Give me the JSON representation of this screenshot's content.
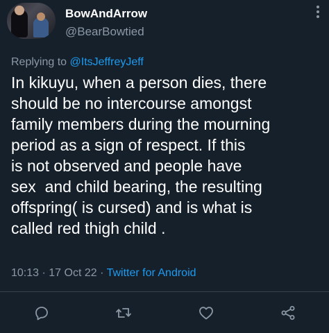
{
  "author": {
    "display_name": "BowAndArrow",
    "handle": "@BearBowtied",
    "avatar_icon": "profile-photo"
  },
  "reply": {
    "prefix": "Replying to ",
    "mention": "@ItsJeffreyJeff"
  },
  "tweet": {
    "lines": [
      "In kikuyu, when a person dies, there",
      "should be no intercourse amongst",
      "family members during the mourning",
      "period as a sign of respect. If this",
      "is not observed and people have",
      "sex  and child bearing, the resulting",
      "offspring( is cursed) and is what is",
      "called red thigh child ."
    ]
  },
  "meta": {
    "time": "10:13",
    "separator1": " · ",
    "date": "17 Oct 22",
    "separator2": " · ",
    "source": "Twitter for Android"
  },
  "actions": {
    "reply_icon": "reply-icon",
    "retweet_icon": "retweet-icon",
    "like_icon": "heart-icon",
    "share_icon": "share-icon"
  },
  "colors": {
    "background": "#15202b",
    "text": "#ffffff",
    "secondary": "#8b98a5",
    "accent": "#1d9bf0"
  }
}
